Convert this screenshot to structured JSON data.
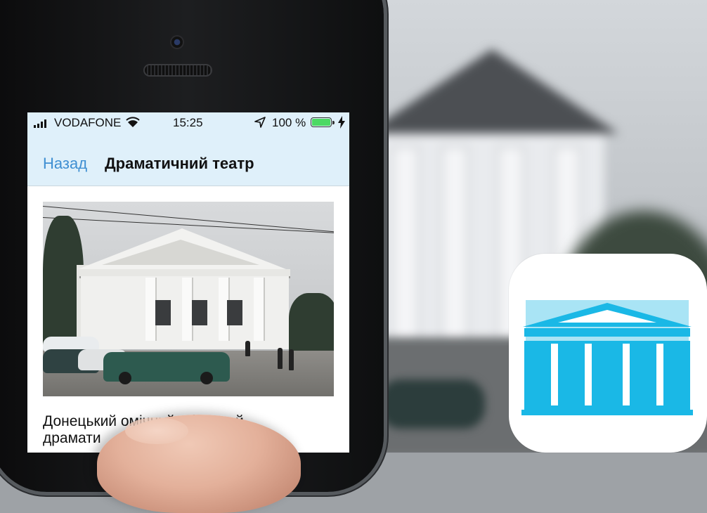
{
  "status_bar": {
    "carrier": "VODAFONE",
    "time": "15:25",
    "battery": "100 %",
    "battery_level": 1.0
  },
  "nav": {
    "back_label": "Назад",
    "title": "Драматичний театр"
  },
  "content": {
    "caption_line1": "Донецький    омічний обласний",
    "caption_line2": "драмати"
  },
  "colors": {
    "accent": "#3f8fd2",
    "navbar_bg": "#dff0fa",
    "battery_green": "#4cd964",
    "icon_blue": "#1ab8e6",
    "icon_light_blue": "#a9e4f5"
  },
  "icons": {
    "status": [
      "signal-icon",
      "wifi-icon",
      "location-arrow-icon",
      "battery-icon",
      "charging-icon"
    ],
    "app": "theatre-building-icon"
  }
}
